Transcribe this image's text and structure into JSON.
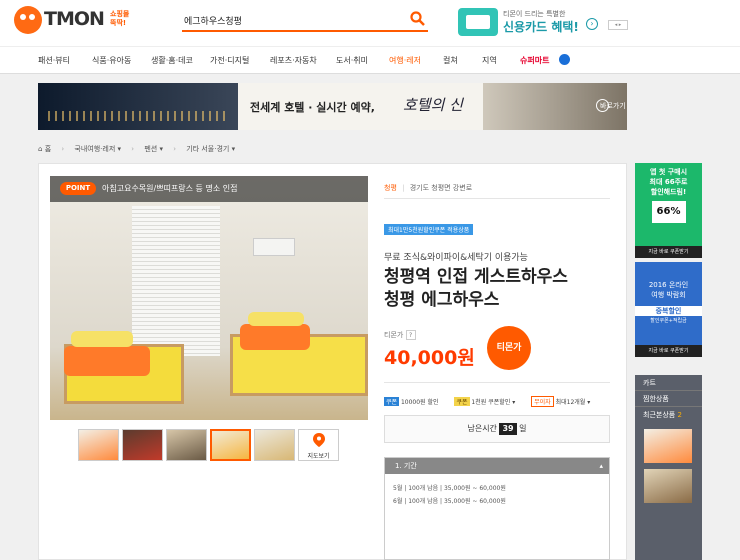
{
  "logo": {
    "brand": "TMON",
    "tagline_line1": "쇼핑몰",
    "tagline_line2": "뚝딱!"
  },
  "search": {
    "query": "에그하우스청평"
  },
  "promo": {
    "line1": "티몬이 드리는 특별한",
    "line2": "신용카드 혜택!"
  },
  "nav": [
    "패션·뷰티",
    "식품·유아동",
    "생활·홈·데코",
    "가전·디지털",
    "레포츠·자동차",
    "도서·취미",
    "여행·레저",
    "컬쳐",
    "지역",
    "슈퍼마트"
  ],
  "banner": {
    "text": "전세계 호텔 · 실시간 예약,",
    "brand": "호텔의 신",
    "link": "바로가기"
  },
  "breadcrumb": {
    "home": "홈",
    "items": [
      "국내여행·레저",
      "펜션",
      "기타 서울·경기"
    ]
  },
  "product": {
    "point_badge": "POINT",
    "point_text": "아침고요수목원/쁘띠프랑스 등 명소 인접",
    "location_tag": "청평",
    "location": "경기도 청평면 강변로",
    "coupon_badge": "최대1만5천원할인쿠폰 적용상품",
    "subtitle": "무료 조식&와이파이&세탁기 이용가능",
    "title_line1": "청평역 인접 게스트하우스",
    "title_line2": "청평 에그하우스",
    "price_label": "티몬가",
    "price_q": "?",
    "price": "40,000원",
    "tmon_price_badge": "티몬가",
    "map_button": "지도보기"
  },
  "benefits": {
    "coupon_icon": "쿠폰",
    "coupon_text": "10000원 할인",
    "coupon2_icon": "쿠폰",
    "coupon2_text": "1천원 쿠폰할인",
    "installment_tag": "무이자",
    "installment_text": "최대12개월"
  },
  "remaining": {
    "prefix": "남은시간",
    "days": "39",
    "suffix": "일"
  },
  "options": {
    "header": "1. 기간",
    "rows": [
      {
        "month": "5월",
        "count": "100개",
        "left": "남음",
        "price": "35,000원 ~ 60,000원"
      },
      {
        "month": "6월",
        "count": "100개",
        "left": "남음",
        "price": "35,000원 ~ 60,000원"
      }
    ]
  },
  "side_ad1": {
    "l1": "앱 첫 구매시",
    "l2": "최대 66주로",
    "l3": "할인해드림!",
    "pct": "66%",
    "link": "지금 바로 쿠폰받기"
  },
  "side_ad2": {
    "l1": "2016 온라인",
    "l2": "여행 박람회",
    "l3": "중복할인",
    "l4": "할인쿠폰+적립금",
    "link": "지금 바로 쿠폰받기"
  },
  "side_panel": {
    "cart": "카트",
    "wish": "찜한상품",
    "recent": "최근본상품",
    "recent_count": "2"
  },
  "colors": {
    "accent": "#ff5a00",
    "blue": "#2a82d6",
    "headerline": "#ff5a00"
  }
}
